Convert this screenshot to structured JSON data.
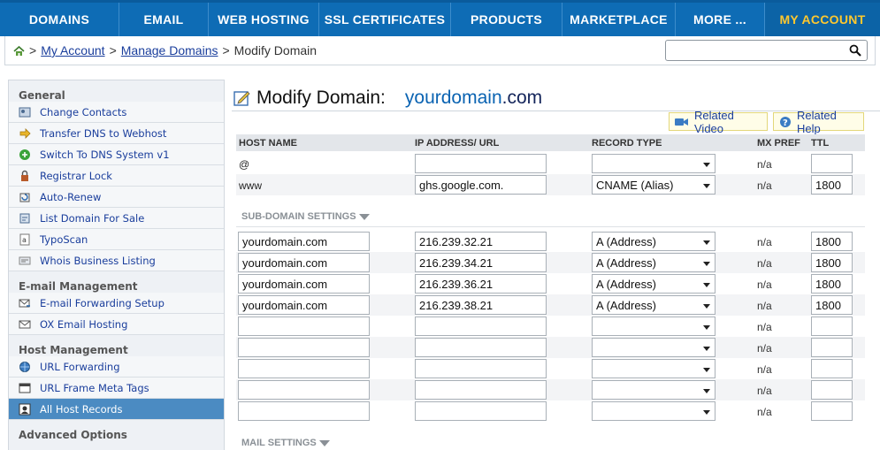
{
  "nav": {
    "items": [
      "DOMAINS",
      "EMAIL",
      "WEB HOSTING",
      "SSL CERTIFICATES",
      "PRODUCTS",
      "MARKETPLACE",
      "MORE ...",
      "MY ACCOUNT"
    ],
    "active_index": 7
  },
  "breadcrumb": {
    "my_account": "My Account",
    "manage_domains": "Manage Domains",
    "current": "Modify Domain",
    "separator": ">"
  },
  "search": {
    "placeholder": "",
    "icon": "search-icon"
  },
  "sidebar": {
    "general_heading": "General",
    "general": [
      {
        "label": "Change Contacts",
        "icon": "contacts-icon"
      },
      {
        "label": "Transfer DNS to Webhost",
        "icon": "arrow-right-icon"
      },
      {
        "label": "Switch To DNS System v1",
        "icon": "switch-icon"
      },
      {
        "label": "Registrar Lock",
        "icon": "lock-icon"
      },
      {
        "label": "Auto-Renew",
        "icon": "renew-icon"
      },
      {
        "label": "List Domain For Sale",
        "icon": "sale-icon"
      },
      {
        "label": "TypoScan",
        "icon": "typoscan-icon"
      },
      {
        "label": "Whois Business Listing",
        "icon": "whois-icon"
      }
    ],
    "email_heading": "E-mail Management",
    "email": [
      {
        "label": "E-mail Forwarding Setup",
        "icon": "email-forward-icon"
      },
      {
        "label": "OX Email Hosting",
        "icon": "envelope-icon"
      }
    ],
    "host_heading": "Host Management",
    "host": [
      {
        "label": "URL Forwarding",
        "icon": "globe-icon"
      },
      {
        "label": "URL Frame Meta Tags",
        "icon": "frame-icon"
      },
      {
        "label": "All Host Records",
        "icon": "host-records-icon",
        "active": true
      }
    ],
    "advanced_heading": "Advanced Options"
  },
  "main": {
    "title_prefix": "Modify Domain:",
    "domain_name": "yourdomain",
    "domain_tld": ".com",
    "related_video": "Related Video",
    "related_help": "Related Help"
  },
  "table": {
    "headers": {
      "host": "HOST NAME",
      "ip": "IP ADDRESS/ URL",
      "type": "RECORD TYPE",
      "mx": "MX PREF",
      "ttl": "TTL"
    },
    "main_rows": [
      {
        "host": "@",
        "ip": "",
        "type": "",
        "mx": "n/a",
        "ttl": ""
      },
      {
        "host": "www",
        "ip": "ghs.google.com.",
        "type": "CNAME (Alias)",
        "mx": "n/a",
        "ttl": "1800"
      }
    ],
    "subdomain_label": "SUB-DOMAIN SETTINGS",
    "sub_rows": [
      {
        "host": "yourdomain.com",
        "ip": "216.239.32.21",
        "type": "A (Address)",
        "mx": "n/a",
        "ttl": "1800"
      },
      {
        "host": "yourdomain.com",
        "ip": "216.239.34.21",
        "type": "A (Address)",
        "mx": "n/a",
        "ttl": "1800"
      },
      {
        "host": "yourdomain.com",
        "ip": "216.239.36.21",
        "type": "A (Address)",
        "mx": "n/a",
        "ttl": "1800"
      },
      {
        "host": "yourdomain.com",
        "ip": "216.239.38.21",
        "type": "A (Address)",
        "mx": "n/a",
        "ttl": "1800"
      },
      {
        "host": "",
        "ip": "",
        "type": "",
        "mx": "n/a",
        "ttl": ""
      },
      {
        "host": "",
        "ip": "",
        "type": "",
        "mx": "n/a",
        "ttl": ""
      },
      {
        "host": "",
        "ip": "",
        "type": "",
        "mx": "n/a",
        "ttl": ""
      },
      {
        "host": "",
        "ip": "",
        "type": "",
        "mx": "n/a",
        "ttl": ""
      },
      {
        "host": "",
        "ip": "",
        "type": "",
        "mx": "n/a",
        "ttl": ""
      }
    ],
    "mail_label": "MAIL SETTINGS"
  },
  "colors": {
    "nav_bg": "#0e6cb5",
    "nav_active_text": "#ffc82e",
    "link": "#1a3e9c",
    "domain_blue": "#0a63b2",
    "sidebar_active": "#4b8bc2"
  }
}
